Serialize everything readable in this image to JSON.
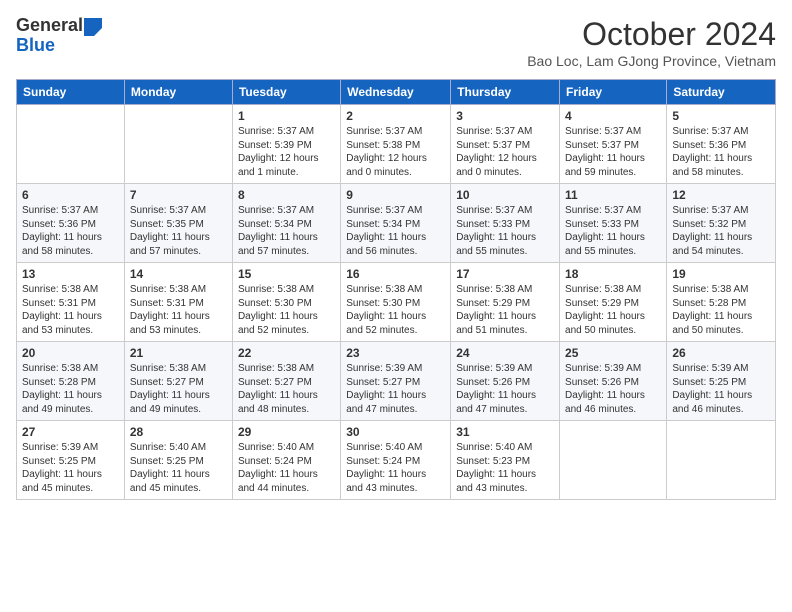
{
  "header": {
    "logo": {
      "line1": "General",
      "line2": "Blue"
    },
    "title": "October 2024",
    "location": "Bao Loc, Lam GJong Province, Vietnam"
  },
  "days_of_week": [
    "Sunday",
    "Monday",
    "Tuesday",
    "Wednesday",
    "Thursday",
    "Friday",
    "Saturday"
  ],
  "weeks": [
    [
      {
        "day": "",
        "info": ""
      },
      {
        "day": "",
        "info": ""
      },
      {
        "day": "1",
        "info": "Sunrise: 5:37 AM\nSunset: 5:39 PM\nDaylight: 12 hours\nand 1 minute."
      },
      {
        "day": "2",
        "info": "Sunrise: 5:37 AM\nSunset: 5:38 PM\nDaylight: 12 hours\nand 0 minutes."
      },
      {
        "day": "3",
        "info": "Sunrise: 5:37 AM\nSunset: 5:37 PM\nDaylight: 12 hours\nand 0 minutes."
      },
      {
        "day": "4",
        "info": "Sunrise: 5:37 AM\nSunset: 5:37 PM\nDaylight: 11 hours\nand 59 minutes."
      },
      {
        "day": "5",
        "info": "Sunrise: 5:37 AM\nSunset: 5:36 PM\nDaylight: 11 hours\nand 58 minutes."
      }
    ],
    [
      {
        "day": "6",
        "info": "Sunrise: 5:37 AM\nSunset: 5:36 PM\nDaylight: 11 hours\nand 58 minutes."
      },
      {
        "day": "7",
        "info": "Sunrise: 5:37 AM\nSunset: 5:35 PM\nDaylight: 11 hours\nand 57 minutes."
      },
      {
        "day": "8",
        "info": "Sunrise: 5:37 AM\nSunset: 5:34 PM\nDaylight: 11 hours\nand 57 minutes."
      },
      {
        "day": "9",
        "info": "Sunrise: 5:37 AM\nSunset: 5:34 PM\nDaylight: 11 hours\nand 56 minutes."
      },
      {
        "day": "10",
        "info": "Sunrise: 5:37 AM\nSunset: 5:33 PM\nDaylight: 11 hours\nand 55 minutes."
      },
      {
        "day": "11",
        "info": "Sunrise: 5:37 AM\nSunset: 5:33 PM\nDaylight: 11 hours\nand 55 minutes."
      },
      {
        "day": "12",
        "info": "Sunrise: 5:37 AM\nSunset: 5:32 PM\nDaylight: 11 hours\nand 54 minutes."
      }
    ],
    [
      {
        "day": "13",
        "info": "Sunrise: 5:38 AM\nSunset: 5:31 PM\nDaylight: 11 hours\nand 53 minutes."
      },
      {
        "day": "14",
        "info": "Sunrise: 5:38 AM\nSunset: 5:31 PM\nDaylight: 11 hours\nand 53 minutes."
      },
      {
        "day": "15",
        "info": "Sunrise: 5:38 AM\nSunset: 5:30 PM\nDaylight: 11 hours\nand 52 minutes."
      },
      {
        "day": "16",
        "info": "Sunrise: 5:38 AM\nSunset: 5:30 PM\nDaylight: 11 hours\nand 52 minutes."
      },
      {
        "day": "17",
        "info": "Sunrise: 5:38 AM\nSunset: 5:29 PM\nDaylight: 11 hours\nand 51 minutes."
      },
      {
        "day": "18",
        "info": "Sunrise: 5:38 AM\nSunset: 5:29 PM\nDaylight: 11 hours\nand 50 minutes."
      },
      {
        "day": "19",
        "info": "Sunrise: 5:38 AM\nSunset: 5:28 PM\nDaylight: 11 hours\nand 50 minutes."
      }
    ],
    [
      {
        "day": "20",
        "info": "Sunrise: 5:38 AM\nSunset: 5:28 PM\nDaylight: 11 hours\nand 49 minutes."
      },
      {
        "day": "21",
        "info": "Sunrise: 5:38 AM\nSunset: 5:27 PM\nDaylight: 11 hours\nand 49 minutes."
      },
      {
        "day": "22",
        "info": "Sunrise: 5:38 AM\nSunset: 5:27 PM\nDaylight: 11 hours\nand 48 minutes."
      },
      {
        "day": "23",
        "info": "Sunrise: 5:39 AM\nSunset: 5:27 PM\nDaylight: 11 hours\nand 47 minutes."
      },
      {
        "day": "24",
        "info": "Sunrise: 5:39 AM\nSunset: 5:26 PM\nDaylight: 11 hours\nand 47 minutes."
      },
      {
        "day": "25",
        "info": "Sunrise: 5:39 AM\nSunset: 5:26 PM\nDaylight: 11 hours\nand 46 minutes."
      },
      {
        "day": "26",
        "info": "Sunrise: 5:39 AM\nSunset: 5:25 PM\nDaylight: 11 hours\nand 46 minutes."
      }
    ],
    [
      {
        "day": "27",
        "info": "Sunrise: 5:39 AM\nSunset: 5:25 PM\nDaylight: 11 hours\nand 45 minutes."
      },
      {
        "day": "28",
        "info": "Sunrise: 5:40 AM\nSunset: 5:25 PM\nDaylight: 11 hours\nand 45 minutes."
      },
      {
        "day": "29",
        "info": "Sunrise: 5:40 AM\nSunset: 5:24 PM\nDaylight: 11 hours\nand 44 minutes."
      },
      {
        "day": "30",
        "info": "Sunrise: 5:40 AM\nSunset: 5:24 PM\nDaylight: 11 hours\nand 43 minutes."
      },
      {
        "day": "31",
        "info": "Sunrise: 5:40 AM\nSunset: 5:23 PM\nDaylight: 11 hours\nand 43 minutes."
      },
      {
        "day": "",
        "info": ""
      },
      {
        "day": "",
        "info": ""
      }
    ]
  ]
}
